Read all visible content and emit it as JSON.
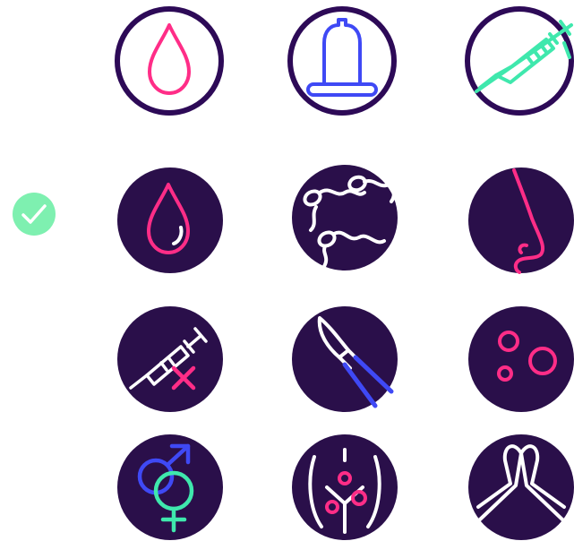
{
  "colors": {
    "navy": "#2a0f4a",
    "outline_ring": "#2d0a57",
    "pink": "#ff2d87",
    "blue": "#3f49f5",
    "mint": "#3fe8ad",
    "white": "#ffffff",
    "check_green": "#7ef0b0"
  },
  "icons": {
    "row1": [
      "blood-drop-outline-icon",
      "condom-icon",
      "no-syringe-icon"
    ],
    "check": "checkmark-icon",
    "row2": [
      "blood-drop-icon",
      "sperm-icon",
      "nose-icon"
    ],
    "row3": [
      "syringe-cross-icon",
      "scalpel-icon",
      "skin-sores-icon"
    ],
    "row4": [
      "gender-symbols-icon",
      "reproductive-system-icon",
      "praying-hands-icon"
    ]
  }
}
